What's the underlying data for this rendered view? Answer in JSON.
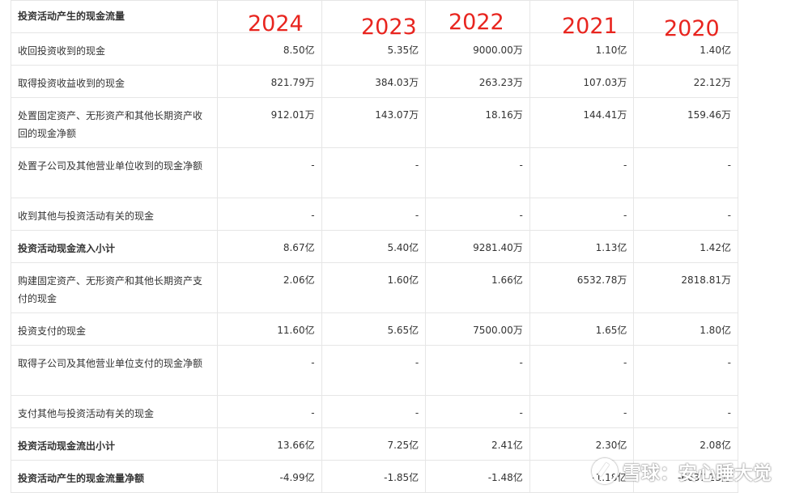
{
  "table": {
    "header_label": "投资活动产生的现金流量",
    "rows": [
      {
        "label": "收回投资收到的现金",
        "bold": false,
        "h": 40,
        "values": [
          "8.50亿",
          "5.35亿",
          "9000.00万",
          "1.10亿",
          "1.40亿"
        ]
      },
      {
        "label": "取得投资收益收到的现金",
        "bold": false,
        "h": 40,
        "values": [
          "821.79万",
          "384.03万",
          "263.23万",
          "107.03万",
          "22.12万"
        ]
      },
      {
        "label": "处置固定资产、无形资产和其他长期资产收回的现金净额",
        "bold": false,
        "h": 62,
        "values": [
          "912.01万",
          "143.07万",
          "18.16万",
          "144.41万",
          "159.46万"
        ]
      },
      {
        "label": "处置子公司及其他营业单位收到的现金净额",
        "bold": false,
        "h": 62,
        "values": [
          "-",
          "-",
          "-",
          "-",
          "-"
        ]
      },
      {
        "label": "收到其他与投资活动有关的现金",
        "bold": false,
        "h": 40,
        "values": [
          "-",
          "-",
          "-",
          "-",
          "-"
        ]
      },
      {
        "label": "投资活动现金流入小计",
        "bold": true,
        "h": 40,
        "values": [
          "8.67亿",
          "5.40亿",
          "9281.40万",
          "1.13亿",
          "1.42亿"
        ]
      },
      {
        "label": "购建固定资产、无形资产和其他长期资产支付的现金",
        "bold": false,
        "h": 62,
        "values": [
          "2.06亿",
          "1.60亿",
          "1.66亿",
          "6532.78万",
          "2818.81万"
        ]
      },
      {
        "label": "投资支付的现金",
        "bold": false,
        "h": 40,
        "values": [
          "11.60亿",
          "5.65亿",
          "7500.00万",
          "1.65亿",
          "1.80亿"
        ]
      },
      {
        "label": "取得子公司及其他营业单位支付的现金净额",
        "bold": false,
        "h": 62,
        "values": [
          "-",
          "-",
          "-",
          "-",
          "-"
        ]
      },
      {
        "label": "支付其他与投资活动有关的现金",
        "bold": false,
        "h": 40,
        "values": [
          "-",
          "-",
          "-",
          "-",
          "-"
        ]
      },
      {
        "label": "投资活动现金流出小计",
        "bold": true,
        "h": 40,
        "values": [
          "13.66亿",
          "7.25亿",
          "2.41亿",
          "2.30亿",
          "2.08亿"
        ]
      },
      {
        "label": "投资活动产生的现金流量净额",
        "bold": true,
        "h": 40,
        "values": [
          "-4.99亿",
          "-1.85亿",
          "-1.48亿",
          "-1.18亿",
          "-6637.23万"
        ]
      }
    ]
  },
  "year_annotations": [
    "2024",
    "2023",
    "2022",
    "2021",
    "2020"
  ],
  "watermark": "雪球：安心睡大觉"
}
